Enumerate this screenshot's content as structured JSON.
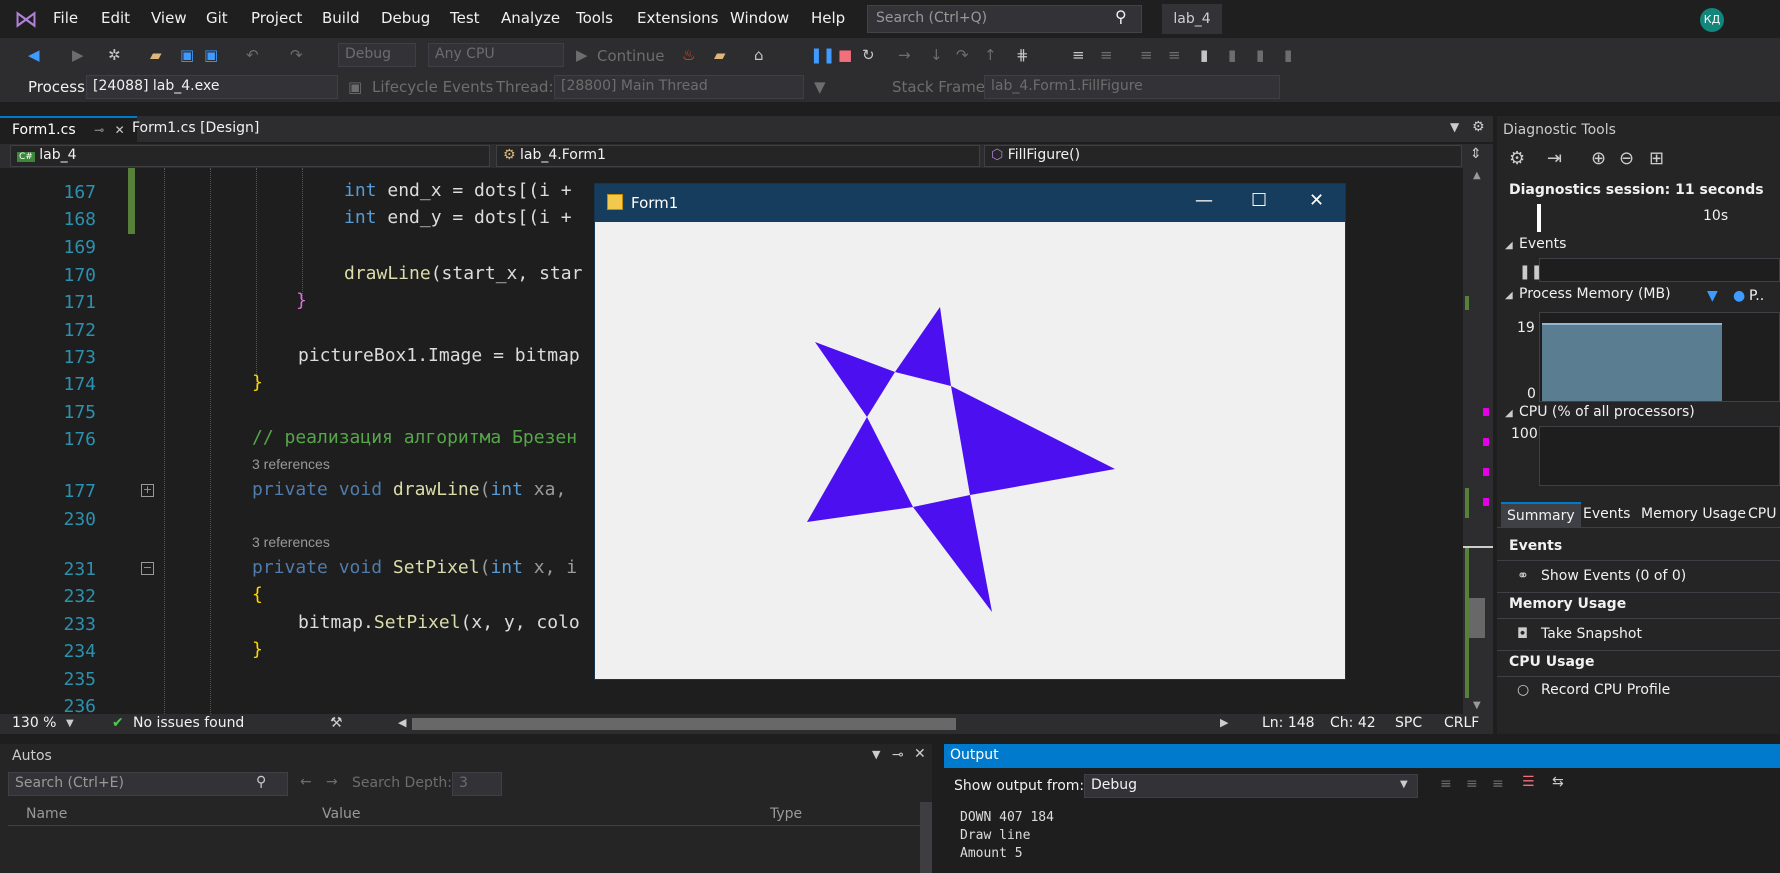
{
  "menu": {
    "items": [
      "File",
      "Edit",
      "View",
      "Git",
      "Project",
      "Build",
      "Debug",
      "Test",
      "Analyze",
      "Tools",
      "Extensions",
      "Window",
      "Help"
    ],
    "search_placeholder": "Search (Ctrl+Q)",
    "solution_name": "lab_4",
    "user_initials": "КД"
  },
  "toolbar": {
    "config": "Debug",
    "platform": "Any CPU",
    "continue_label": "Continue"
  },
  "locbar": {
    "process_label": "Process:",
    "process_value": "[24088] lab_4.exe",
    "lifecycle_label": "Lifecycle Events",
    "thread_label": "Thread:",
    "thread_value": "[28800] Main Thread",
    "stack_label": "Stack Frame:",
    "stack_value": "lab_4.Form1.FillFigure"
  },
  "editor": {
    "tabs": [
      "Form1.cs",
      "Form1.cs [Design]"
    ],
    "nav_project": "lab_4",
    "nav_class": "lab_4.Form1",
    "nav_member": "FillFigure()",
    "lines": [
      {
        "num": "167",
        "code": "int end_x = dots[(i +"
      },
      {
        "num": "168",
        "code": "int end_y = dots[(i +"
      },
      {
        "num": "169",
        "code": ""
      },
      {
        "num": "170",
        "code": "drawLine(start_x, star"
      },
      {
        "num": "171",
        "code": "}"
      },
      {
        "num": "172",
        "code": ""
      },
      {
        "num": "173",
        "code": "pictureBox1.Image = bitmap"
      },
      {
        "num": "174",
        "code": "}"
      },
      {
        "num": "175",
        "code": ""
      },
      {
        "num": "176",
        "code": "// реализация алгоритма Брезен"
      },
      {
        "num": "177",
        "code": "private void drawLine(int xa,"
      },
      {
        "num": "230",
        "code": ""
      },
      {
        "num": "231",
        "code": "private void SetPixel(int x, i"
      },
      {
        "num": "232",
        "code": "{"
      },
      {
        "num": "233",
        "code": "bitmap.SetPixel(x, y, colo"
      },
      {
        "num": "234",
        "code": "}"
      },
      {
        "num": "235",
        "code": ""
      },
      {
        "num": "236",
        "code": ""
      }
    ],
    "references": "3 references",
    "zoom": "130 %",
    "issues": "No issues found",
    "ln": "Ln: 148",
    "ch": "Ch: 42",
    "spc": "SPC",
    "crlf": "CRLF"
  },
  "form1": {
    "title": "Form1",
    "fill_color": "#4b0ff0"
  },
  "diagnostics": {
    "title": "Diagnostic Tools",
    "session": "Diagnostics session: 11 seconds",
    "timeline_tick": "10s",
    "events_label": "Events",
    "memory_label": "Process Memory (MB)",
    "memory_legend": "P..",
    "memory_max": "19",
    "memory_min": "0",
    "cpu_label": "CPU (% of all processors)",
    "cpu_max": "100",
    "tabs": [
      "Summary",
      "Events",
      "Memory Usage",
      "CPU"
    ],
    "summary_events_h": "Events",
    "show_events": "Show Events (0 of 0)",
    "memory_usage_h": "Memory Usage",
    "take_snapshot": "Take Snapshot",
    "cpu_usage_h": "CPU Usage",
    "record_cpu": "Record CPU Profile"
  },
  "autos": {
    "title": "Autos",
    "search_placeholder": "Search (Ctrl+E)",
    "search_depth_label": "Search Depth:",
    "search_depth_value": "3",
    "columns": [
      "Name",
      "Value",
      "Type"
    ]
  },
  "output": {
    "title": "Output",
    "show_from_label": "Show output from:",
    "show_from_value": "Debug",
    "lines": [
      "DOWN 407 184",
      "Draw line",
      "Amount 5"
    ]
  }
}
